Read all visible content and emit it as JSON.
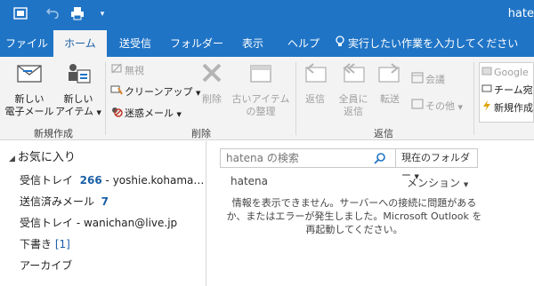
{
  "window": {
    "title_partial": "hate"
  },
  "tabs": [
    {
      "label": "ファイル"
    },
    {
      "label": "ホーム"
    },
    {
      "label": "送受信"
    },
    {
      "label": "フォルダー"
    },
    {
      "label": "表示"
    },
    {
      "label": "ヘルプ"
    },
    {
      "label": "実行したい作業を入力してください"
    }
  ],
  "ribbon": {
    "new_group": {
      "label": "新規作成",
      "new_mail_line1": "新しい",
      "new_mail_line2": "電子メール",
      "new_item_line1": "新しい",
      "new_item_line2": "アイテム"
    },
    "delete_group": {
      "label": "削除",
      "ignore": "無視",
      "cleanup": "クリーンアップ",
      "junk": "迷惑メール",
      "delete": "削除",
      "old_items_line1": "古いアイテム",
      "old_items_line2": "の整理"
    },
    "reply_group": {
      "label": "返信",
      "reply": "返信",
      "reply_all_line1": "全員に",
      "reply_all_line2": "返信",
      "forward": "転送",
      "meeting": "会議",
      "more": "その他"
    },
    "quick_steps": {
      "item1": "Google",
      "item2": "チーム宛",
      "item3": "新規作成"
    }
  },
  "folders": {
    "favorites_label": "お気に入り",
    "items": [
      {
        "name": "受信トレイ",
        "count": "266",
        "suffix": "- yoshie.kohama…"
      },
      {
        "name": "送信済みメール",
        "count": "7",
        "suffix": ""
      },
      {
        "name": "受信トレイ - wanichan@live.jp",
        "count": "",
        "suffix": ""
      },
      {
        "name": "下書き",
        "count": "[1]",
        "suffix": ""
      },
      {
        "name": "アーカイブ",
        "count": "",
        "suffix": ""
      }
    ]
  },
  "main": {
    "search_placeholder": "hatena の検索",
    "scope_label": "現在のフォルダー",
    "account": "hatena",
    "mention_label": "メンション",
    "error_line1": "情報を表示できません。サーバーへの接続に問題がある",
    "error_line2": "か、またはエラーが発生しました。Microsoft Outlook を",
    "error_line3": "再起動してください。"
  },
  "colors": {
    "accent": "#1f74c6",
    "ribbon_bg": "#f3f3f3",
    "link": "#1a5fa6"
  }
}
